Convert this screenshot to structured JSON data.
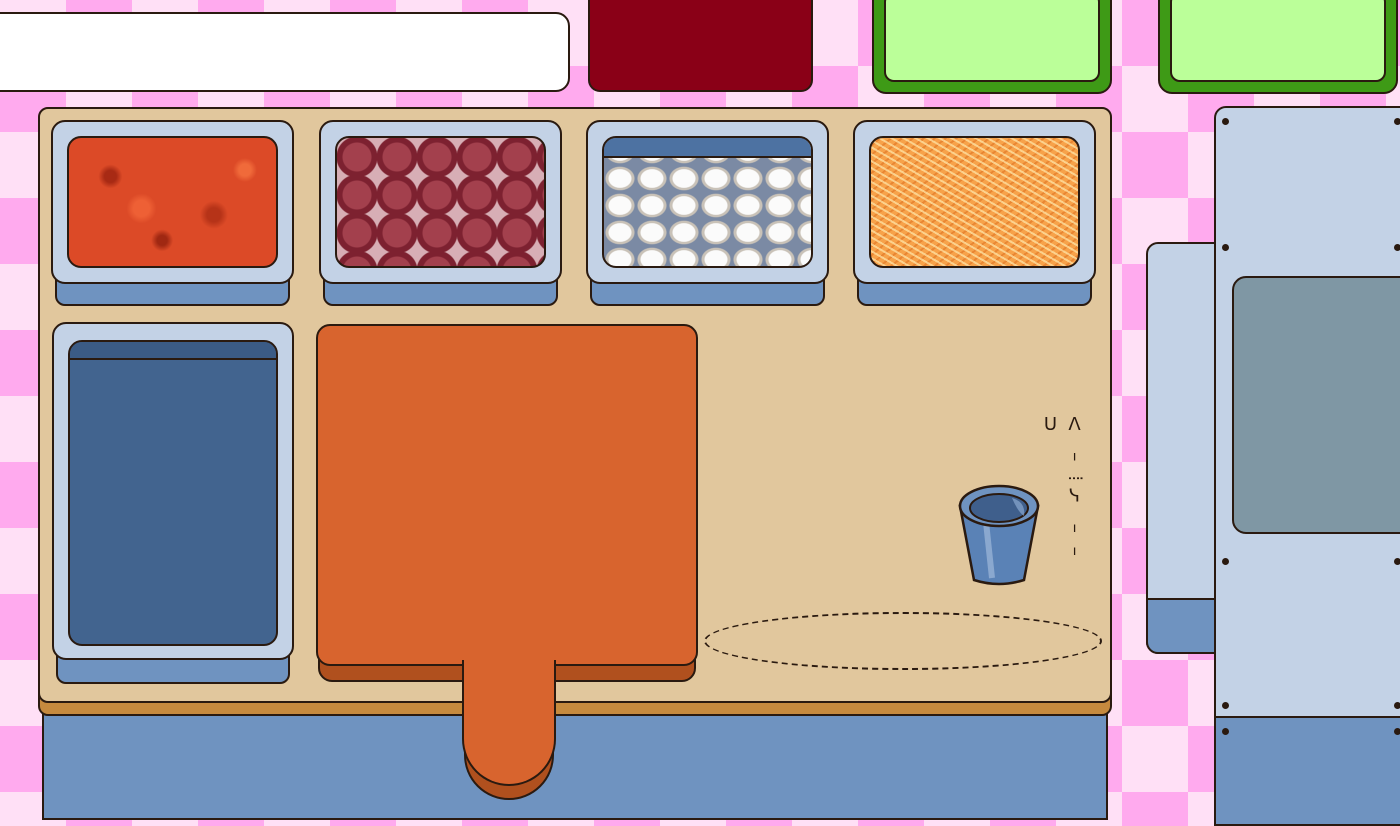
{
  "scene": "pizza-prep-station",
  "colors": {
    "background_pink": "#ffaaee",
    "counter_top": "#e1c79d",
    "counter_edge": "#c68a3e",
    "tray": "#c3d2e6",
    "tray_shadow": "#6f93c0",
    "cutting_board": "#d8642e",
    "red_tray": "#8a0017",
    "green_tray": "#bbff99",
    "oven_window": "#7f97a4"
  },
  "order_bar": {
    "text": ""
  },
  "ingredients": [
    {
      "id": "sauce",
      "icon": "tomato-sauce-icon"
    },
    {
      "id": "pepperoni",
      "icon": "pepperoni-icon"
    },
    {
      "id": "mushrooms",
      "icon": "mushroom-icon"
    },
    {
      "id": "cheese",
      "icon": "shredded-cheese-icon"
    }
  ],
  "dough_bin": {
    "icon": "dough-tray-icon"
  },
  "cutting_board": {
    "icon": "pizza-peel-icon"
  },
  "cup": {
    "icon": "cup-icon"
  },
  "scale_label": {
    "text": "ᐱ ᑊ⁞ᓭ ᑊᑊ ᑌ"
  },
  "oven": {
    "icon": "oven-icon"
  }
}
